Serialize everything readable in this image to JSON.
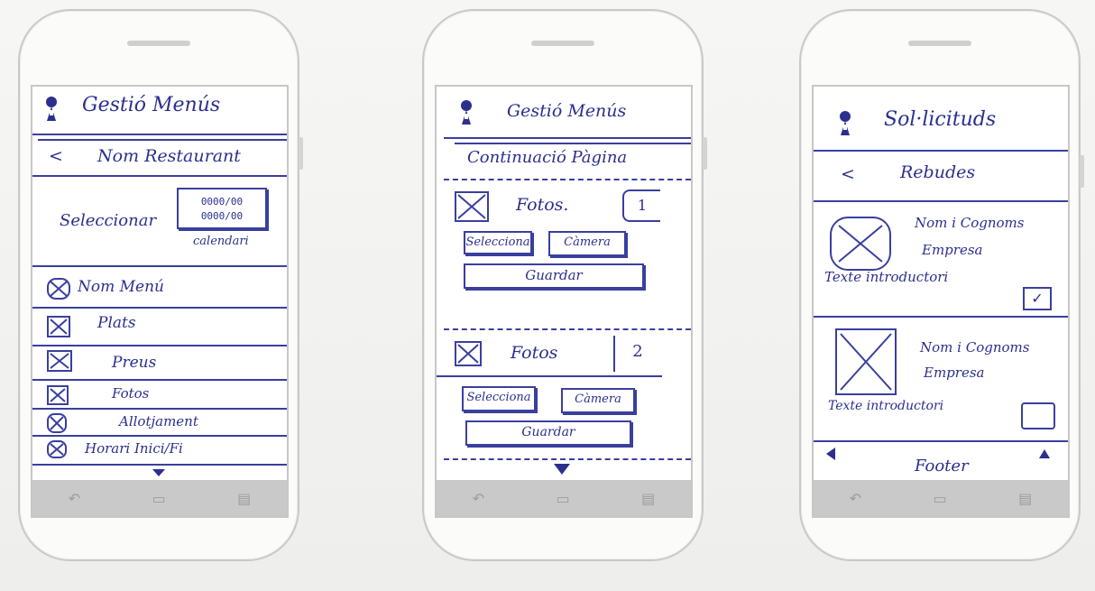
{
  "phones": [
    {
      "title": "Gestió Menús",
      "back_icon": "<",
      "subheader": "Nom Restaurant",
      "select_label": "Seleccionar",
      "calendar_rows": [
        "0000/00",
        "0000/00"
      ],
      "calendar_label": "calendari",
      "list_items": [
        {
          "label": "Nom Menú"
        },
        {
          "label": "Plats"
        },
        {
          "label": "Preus"
        },
        {
          "label": "Fotos"
        },
        {
          "label": "Allotjament"
        },
        {
          "label": "Horari Inici/Fi"
        }
      ],
      "nav_icons": [
        "back-icon",
        "home-icon",
        "recents-icon"
      ]
    },
    {
      "title": "Gestió Menús",
      "subheader": "Continuació Pàgina",
      "sections": [
        {
          "label": "Fotos.",
          "number": "1",
          "select": "Selecciona",
          "camera": "Càmera",
          "save": "Guardar"
        },
        {
          "label": "Fotos",
          "number": "2",
          "select": "Selecciona",
          "camera": "Càmera",
          "save": "Guardar"
        }
      ],
      "nav_icons": [
        "back-icon",
        "home-icon",
        "recents-icon"
      ]
    },
    {
      "title": "Sol·licituds",
      "back_icon": "<",
      "subheader": "Rebudes",
      "requests": [
        {
          "name": "Nom i Cognoms",
          "company": "Empresa",
          "text": "Texte introductori",
          "checked": true
        },
        {
          "name": "Nom i Cognoms",
          "company": "Empresa",
          "text": "Texte introductori",
          "checked": false
        }
      ],
      "footer": "Footer",
      "nav_icons": [
        "back-icon",
        "home-icon",
        "recents-icon"
      ]
    }
  ]
}
